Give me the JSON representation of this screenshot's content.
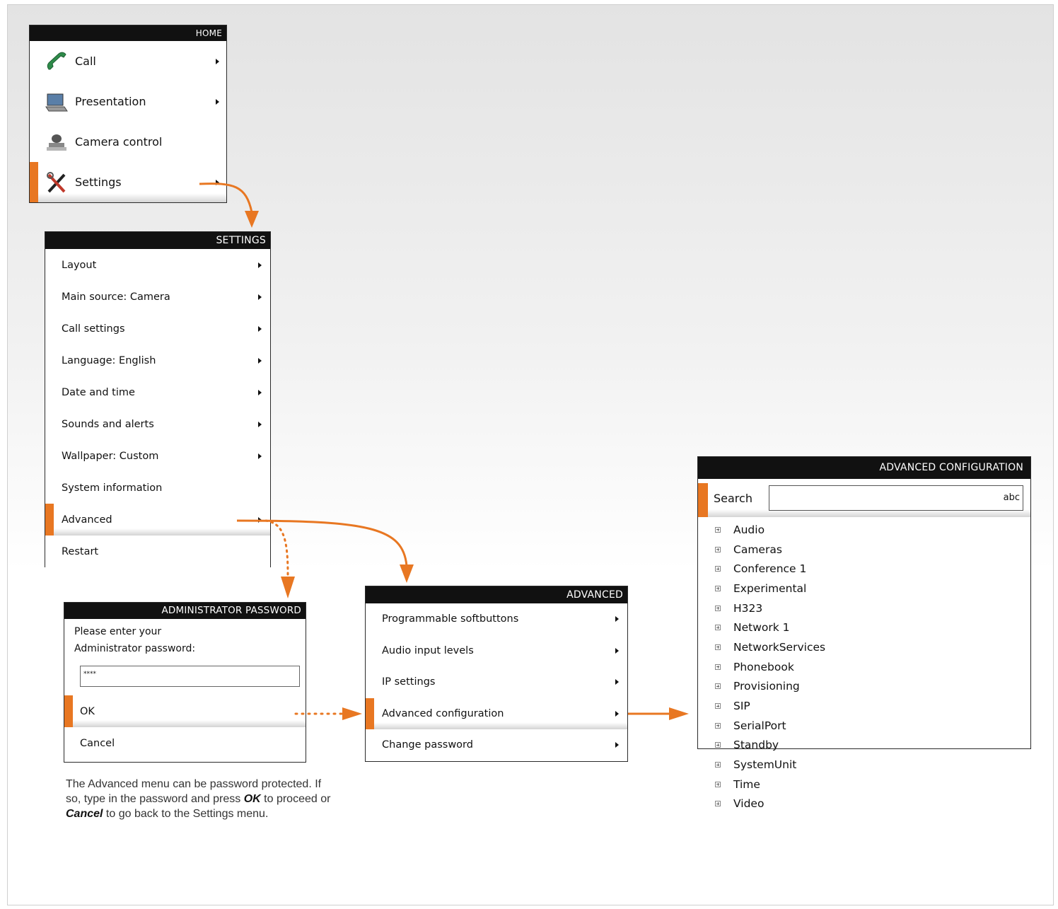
{
  "home": {
    "title": "HOME",
    "items": [
      {
        "label": "Call",
        "icon": "phone-icon",
        "has_arrow": true
      },
      {
        "label": "Presentation",
        "icon": "laptop-icon",
        "has_arrow": true
      },
      {
        "label": "Camera control",
        "icon": "camera-icon",
        "has_arrow": false
      },
      {
        "label": "Settings",
        "icon": "tools-icon",
        "has_arrow": true,
        "selected": true
      }
    ]
  },
  "settings": {
    "title": "SETTINGS",
    "items": [
      {
        "label": "Layout",
        "has_arrow": true
      },
      {
        "label": "Main source: Camera",
        "has_arrow": true
      },
      {
        "label": "Call settings",
        "has_arrow": true
      },
      {
        "label": "Language: English",
        "has_arrow": true
      },
      {
        "label": "Date and time",
        "has_arrow": true
      },
      {
        "label": "Sounds and alerts",
        "has_arrow": true
      },
      {
        "label": "Wallpaper: Custom",
        "has_arrow": true
      },
      {
        "label": "System information",
        "has_arrow": false
      },
      {
        "label": "Advanced",
        "has_arrow": true,
        "selected": true
      },
      {
        "label": "Restart",
        "has_arrow": false
      }
    ]
  },
  "admin": {
    "title": "ADMINISTRATOR PASSWORD",
    "prompt_line1": "Please enter your",
    "prompt_line2": "Administrator password:",
    "password_value": "****",
    "ok_label": "OK",
    "cancel_label": "Cancel"
  },
  "advanced": {
    "title": "ADVANCED",
    "items": [
      {
        "label": "Programmable softbuttons",
        "has_arrow": true
      },
      {
        "label": "Audio input levels",
        "has_arrow": true
      },
      {
        "label": "IP settings",
        "has_arrow": true
      },
      {
        "label": "Advanced configuration",
        "has_arrow": true,
        "selected": true
      },
      {
        "label": "Change password",
        "has_arrow": true
      }
    ]
  },
  "advconf": {
    "title": "ADVANCED CONFIGURATION",
    "search_label": "Search",
    "search_mode": "abc",
    "tree": [
      "Audio",
      "Cameras",
      "Conference 1",
      "Experimental",
      "H323",
      "Network 1",
      "NetworkServices",
      "Phonebook",
      "Provisioning",
      "SIP",
      "SerialPort",
      "Standby",
      "SystemUnit",
      "Time",
      "Video"
    ]
  },
  "note": {
    "part1": "The Advanced menu can be password protected. If so, type in the password and press ",
    "ok": "OK",
    "part2": " to proceed or ",
    "cancel": "Cancel",
    "part3": " to go back to the Settings menu."
  },
  "colors": {
    "accent": "#e87722",
    "header": "#111111"
  }
}
